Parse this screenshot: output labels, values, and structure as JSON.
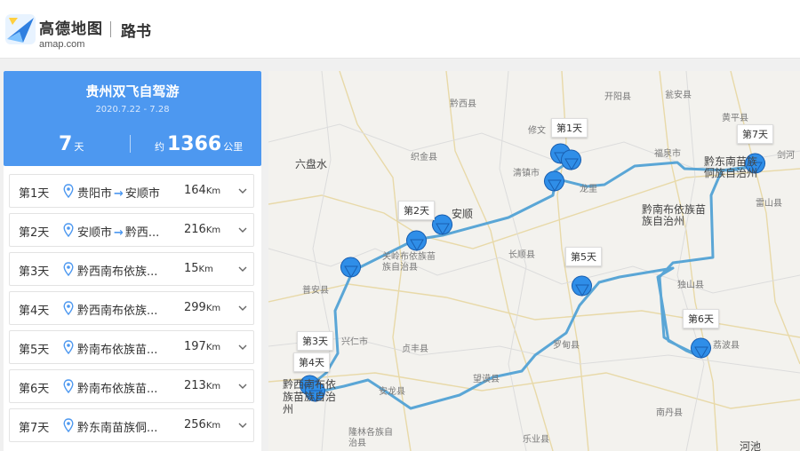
{
  "header": {
    "brand_cn": "高德地图",
    "brand_en": "amap.com",
    "page_name": "路书",
    "logo_icon": "amap-logo-icon"
  },
  "trip": {
    "title": "贵州双飞自驾游",
    "date_range": "2020.7.22 - 7.28",
    "days_value": "7",
    "days_unit": "天",
    "distance_prefix": "约",
    "distance_value": "1366",
    "distance_unit": "公里"
  },
  "days": [
    {
      "label": "第1天",
      "from": "贵阳市",
      "to": "安顺市",
      "distance": "164",
      "unit": "Km"
    },
    {
      "label": "第2天",
      "from": "安顺市",
      "to": "黔西...",
      "distance": "216",
      "unit": "Km"
    },
    {
      "label": "第3天",
      "text": "黔西南布依族...",
      "distance": "15",
      "unit": "Km"
    },
    {
      "label": "第4天",
      "text": "黔西南布依族...",
      "distance": "299",
      "unit": "Km"
    },
    {
      "label": "第5天",
      "text": "黔南布依族苗...",
      "distance": "197",
      "unit": "Km"
    },
    {
      "label": "第6天",
      "text": "黔南布依族苗...",
      "distance": "213",
      "unit": "Km"
    },
    {
      "label": "第7天",
      "text": "黔东南苗族侗...",
      "distance": "256",
      "unit": "Km"
    }
  ],
  "map": {
    "route_color": "#5aa6d6",
    "marker_color": "#2f8ee8",
    "day_tags": [
      "第1天",
      "第2天",
      "第3天",
      "第4天",
      "第5天",
      "第6天",
      "第7天"
    ],
    "places": {
      "kaiyang": "开阳县",
      "qianxi": "黔西县",
      "xiwen": "修文",
      "weng": "瓮安县",
      "liupanshui": "六盘水",
      "zhijin": "织金县",
      "qingzhen": "清镇市",
      "fuquan": "福泉市",
      "huangping": "黄平县",
      "qiandongnan": "黔东南苗族侗族自治州",
      "jianhe": "剑河",
      "leishan": "雷山县",
      "anshun": "安顺",
      "longli": "龙里",
      "qiannan": "黔南布依族苗族自治州",
      "guanling": "关岭布依族苗族自治县",
      "changshun": "长顺县",
      "puan": "普安县",
      "dushan": "独山县",
      "xingren": "兴仁市",
      "zhenfeng": "贞丰县",
      "luodian": "罗甸县",
      "qianxinan": "黔西南布依族苗族自治州",
      "wangmo": "望谟县",
      "anlong": "安龙县",
      "libo": "荔波县",
      "nandan": "南丹县",
      "longlin": "隆林各族自治县",
      "leye": "乐业县",
      "hechi": "河池"
    }
  }
}
